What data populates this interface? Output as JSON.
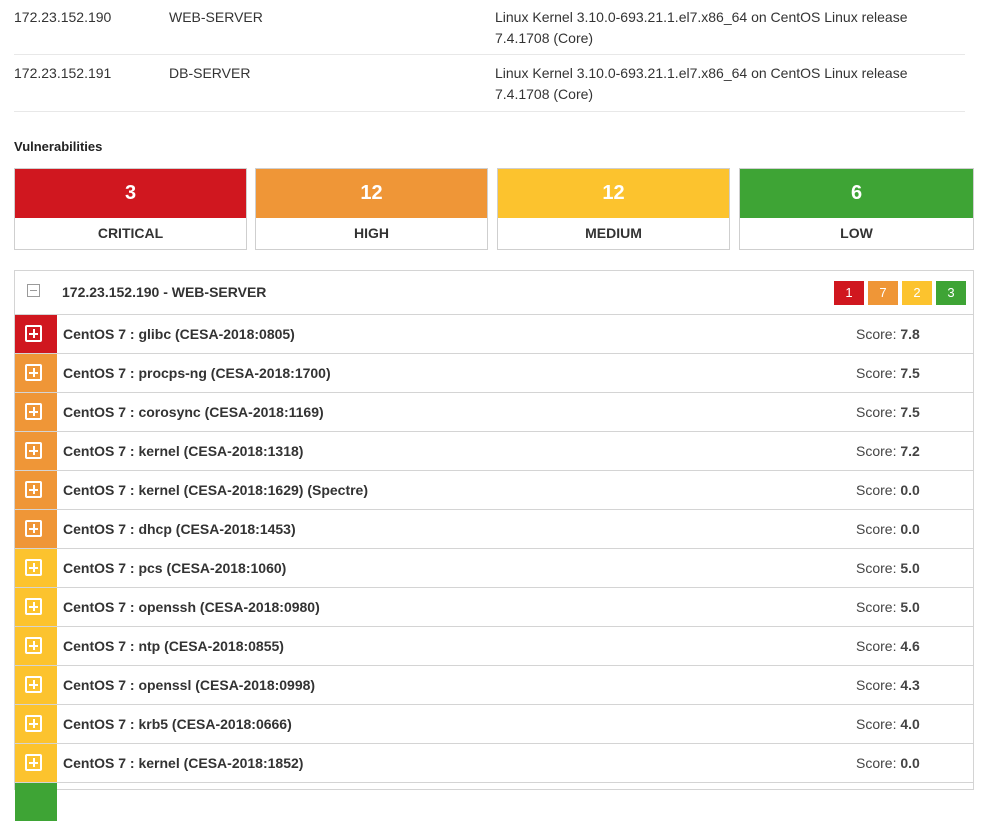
{
  "hosts": [
    {
      "ip": "172.23.152.190",
      "name": "WEB-SERVER",
      "os_line1": "Linux Kernel 3.10.0-693.21.1.el7.x86_64 on CentOS Linux release",
      "os_line2": "7.4.1708 (Core)"
    },
    {
      "ip": "172.23.152.191",
      "name": "DB-SERVER",
      "os_line1": "Linux Kernel 3.10.0-693.21.1.el7.x86_64 on CentOS Linux release",
      "os_line2": "7.4.1708 (Core)"
    }
  ],
  "vulnerabilities_title": "Vulnerabilities",
  "severity_summary": [
    {
      "count": "3",
      "label": "CRITICAL",
      "color": "#d0171f"
    },
    {
      "count": "12",
      "label": "HIGH",
      "color": "#ef9637"
    },
    {
      "count": "12",
      "label": "MEDIUM",
      "color": "#fcc32e"
    },
    {
      "count": "6",
      "label": "LOW",
      "color": "#3ea435"
    }
  ],
  "host_panel": {
    "title": "172.23.152.190 - WEB-SERVER",
    "badges": [
      {
        "value": "1",
        "color": "#d0171f"
      },
      {
        "value": "7",
        "color": "#ef9637"
      },
      {
        "value": "2",
        "color": "#fcc32e"
      },
      {
        "value": "3",
        "color": "#3ea435"
      }
    ],
    "score_label": "Score:",
    "rows": [
      {
        "name": "CentOS 7 : glibc (CESA-2018:0805)",
        "score": "7.8",
        "color": "#d0171f"
      },
      {
        "name": "CentOS 7 : procps-ng (CESA-2018:1700)",
        "score": "7.5",
        "color": "#ef9637"
      },
      {
        "name": "CentOS 7 : corosync (CESA-2018:1169)",
        "score": "7.5",
        "color": "#ef9637"
      },
      {
        "name": "CentOS 7 : kernel (CESA-2018:1318)",
        "score": "7.2",
        "color": "#ef9637"
      },
      {
        "name": "CentOS 7 : kernel (CESA-2018:1629) (Spectre)",
        "score": "0.0",
        "color": "#ef9637"
      },
      {
        "name": "CentOS 7 : dhcp (CESA-2018:1453)",
        "score": "0.0",
        "color": "#ef9637"
      },
      {
        "name": "CentOS 7 : pcs (CESA-2018:1060)",
        "score": "5.0",
        "color": "#fcc32e"
      },
      {
        "name": "CentOS 7 : openssh (CESA-2018:0980)",
        "score": "5.0",
        "color": "#fcc32e"
      },
      {
        "name": "CentOS 7 : ntp (CESA-2018:0855)",
        "score": "4.6",
        "color": "#fcc32e"
      },
      {
        "name": "CentOS 7 : openssl (CESA-2018:0998)",
        "score": "4.3",
        "color": "#fcc32e"
      },
      {
        "name": "CentOS 7 : krb5 (CESA-2018:0666)",
        "score": "4.0",
        "color": "#fcc32e"
      },
      {
        "name": "CentOS 7 : kernel (CESA-2018:1852)",
        "score": "0.0",
        "color": "#fcc32e"
      }
    ],
    "partial_row_color": "#3ea435"
  }
}
